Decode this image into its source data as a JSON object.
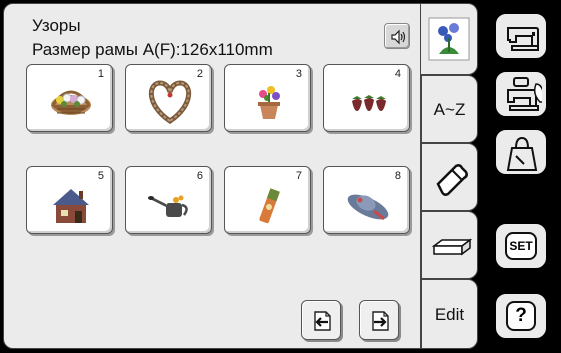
{
  "header": {
    "title": "Узоры",
    "frame_size": "Размер рамы A(F):126x110mm"
  },
  "icons": {
    "sound": "speaker-icon"
  },
  "patterns": [
    {
      "number": "1",
      "icon": "flower-basket"
    },
    {
      "number": "2",
      "icon": "heart-wreath"
    },
    {
      "number": "3",
      "icon": "flower-pot"
    },
    {
      "number": "4",
      "icon": "strawberries"
    },
    {
      "number": "5",
      "icon": "house"
    },
    {
      "number": "6",
      "icon": "watering-can"
    },
    {
      "number": "7",
      "icon": "seed-packet"
    },
    {
      "number": "8",
      "icon": "sun-hat"
    }
  ],
  "category_tabs": [
    {
      "label": "",
      "icon": "flowers-icon",
      "selected": true
    },
    {
      "label": "A~Z",
      "icon": "",
      "selected": false
    },
    {
      "label": "",
      "icon": "eraser-icon",
      "selected": false
    },
    {
      "label": "",
      "icon": "cushion-icon",
      "selected": false
    },
    {
      "label": "Edit",
      "icon": "",
      "selected": false
    }
  ],
  "side_buttons": [
    {
      "label": "",
      "icon": "sewing-machine-icon"
    },
    {
      "label": "",
      "icon": "embroidery-machine-icon"
    },
    {
      "label": "",
      "icon": "bag-icon"
    },
    {
      "label": "SET",
      "icon": ""
    },
    {
      "label": "?",
      "icon": ""
    }
  ],
  "colors": {
    "panel": "#ebebeb",
    "background": "#000000",
    "tile": "#ffffff"
  }
}
